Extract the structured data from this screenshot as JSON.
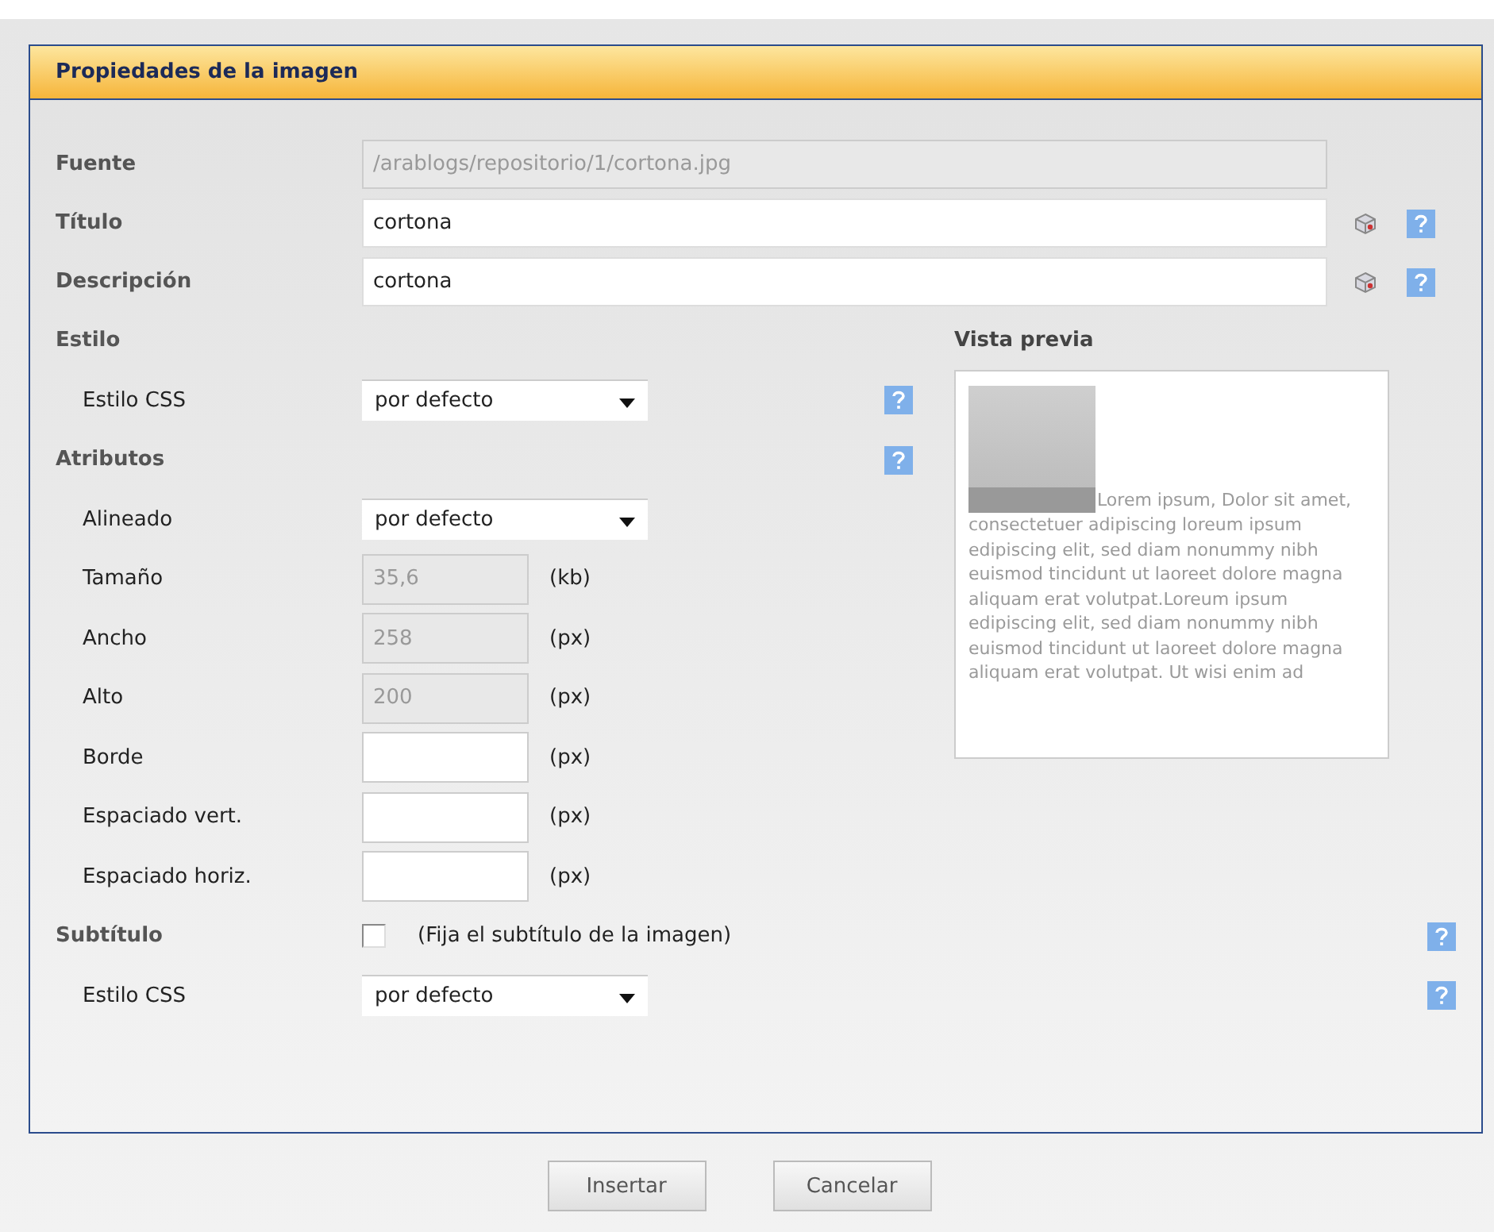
{
  "dialog": {
    "title": "Propiedades de la imagen"
  },
  "fields": [
    {
      "label": "Fuente",
      "value": "/arablogs/repositorio/1/cortona.jpg",
      "disabled": true,
      "actions": false
    },
    {
      "label": "Título",
      "value": "cortona",
      "disabled": false,
      "actions": true
    },
    {
      "label": "Descripción",
      "value": "cortona",
      "disabled": false,
      "actions": true
    }
  ],
  "estilo": {
    "heading": "Estilo",
    "label": "Estilo CSS",
    "value": "por defecto"
  },
  "atributos": {
    "heading": "Atributos",
    "align_label": "Alineado",
    "align_value": "por defecto",
    "sizes": [
      {
        "label": "Tamaño",
        "value": "35,6",
        "unit": "(kb)",
        "disabled": true
      },
      {
        "label": "Ancho",
        "value": "258",
        "unit": "(px)",
        "disabled": true
      },
      {
        "label": "Alto",
        "value": "200",
        "unit": "(px)",
        "disabled": true
      },
      {
        "label": "Borde",
        "unit": "(px)",
        "disabled": false
      },
      {
        "label": "Espaciado vert.",
        "unit": "(px)",
        "disabled": false
      },
      {
        "label": "Espaciado horiz.",
        "unit": "(px)",
        "disabled": false
      }
    ]
  },
  "preview": {
    "title": "Vista previa",
    "text": "Lorem ipsum, Dolor sit amet, consectetuer adipiscing loreum ipsum edipiscing elit, sed diam nonummy nibh euismod tincidunt ut laoreet dolore magna aliquam erat volutpat.Loreum ipsum edipiscing elit, sed diam nonummy nibh euismod tincidunt ut laoreet dolore magna aliquam erat volutpat. Ut wisi enim ad"
  },
  "subtitle": {
    "heading": "Subtítulo",
    "checked": false,
    "label": "(Fija el subtítulo de la imagen)",
    "css_label": "Estilo CSS",
    "css_value": "por defecto"
  },
  "buttons": [
    "Insertar",
    "Cancelar"
  ]
}
